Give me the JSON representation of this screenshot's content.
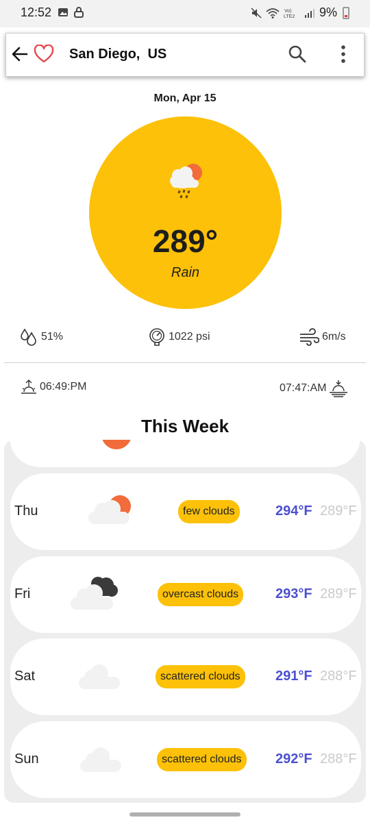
{
  "status": {
    "time": "12:52",
    "battery": "9%"
  },
  "header": {
    "city": "San Diego,  US"
  },
  "current": {
    "date": "Mon, Apr 15",
    "temp": "289°",
    "condition": "Rain",
    "humidity": "51%",
    "pressure": "1022 psi",
    "wind": "6m/s",
    "sunrise": "06:49:PM",
    "sunset": "07:47:AM"
  },
  "week": {
    "title": "This Week",
    "days": [
      {
        "day": "Thu",
        "desc": "few clouds",
        "hi": "294°F",
        "lo": "289°F",
        "icon": "few-clouds-icon"
      },
      {
        "day": "Fri",
        "desc": "overcast clouds",
        "hi": "293°F",
        "lo": "289°F",
        "icon": "overcast-clouds-icon"
      },
      {
        "day": "Sat",
        "desc": "scattered clouds",
        "hi": "291°F",
        "lo": "288°F",
        "icon": "scattered-clouds-icon"
      },
      {
        "day": "Sun",
        "desc": "scattered clouds",
        "hi": "292°F",
        "lo": "288°F",
        "icon": "scattered-clouds-icon"
      }
    ]
  },
  "colors": {
    "accent": "#fcc108",
    "high_temp": "#4b4fcf",
    "low_temp": "#c9c9c9",
    "sun": "#f26b3a"
  }
}
